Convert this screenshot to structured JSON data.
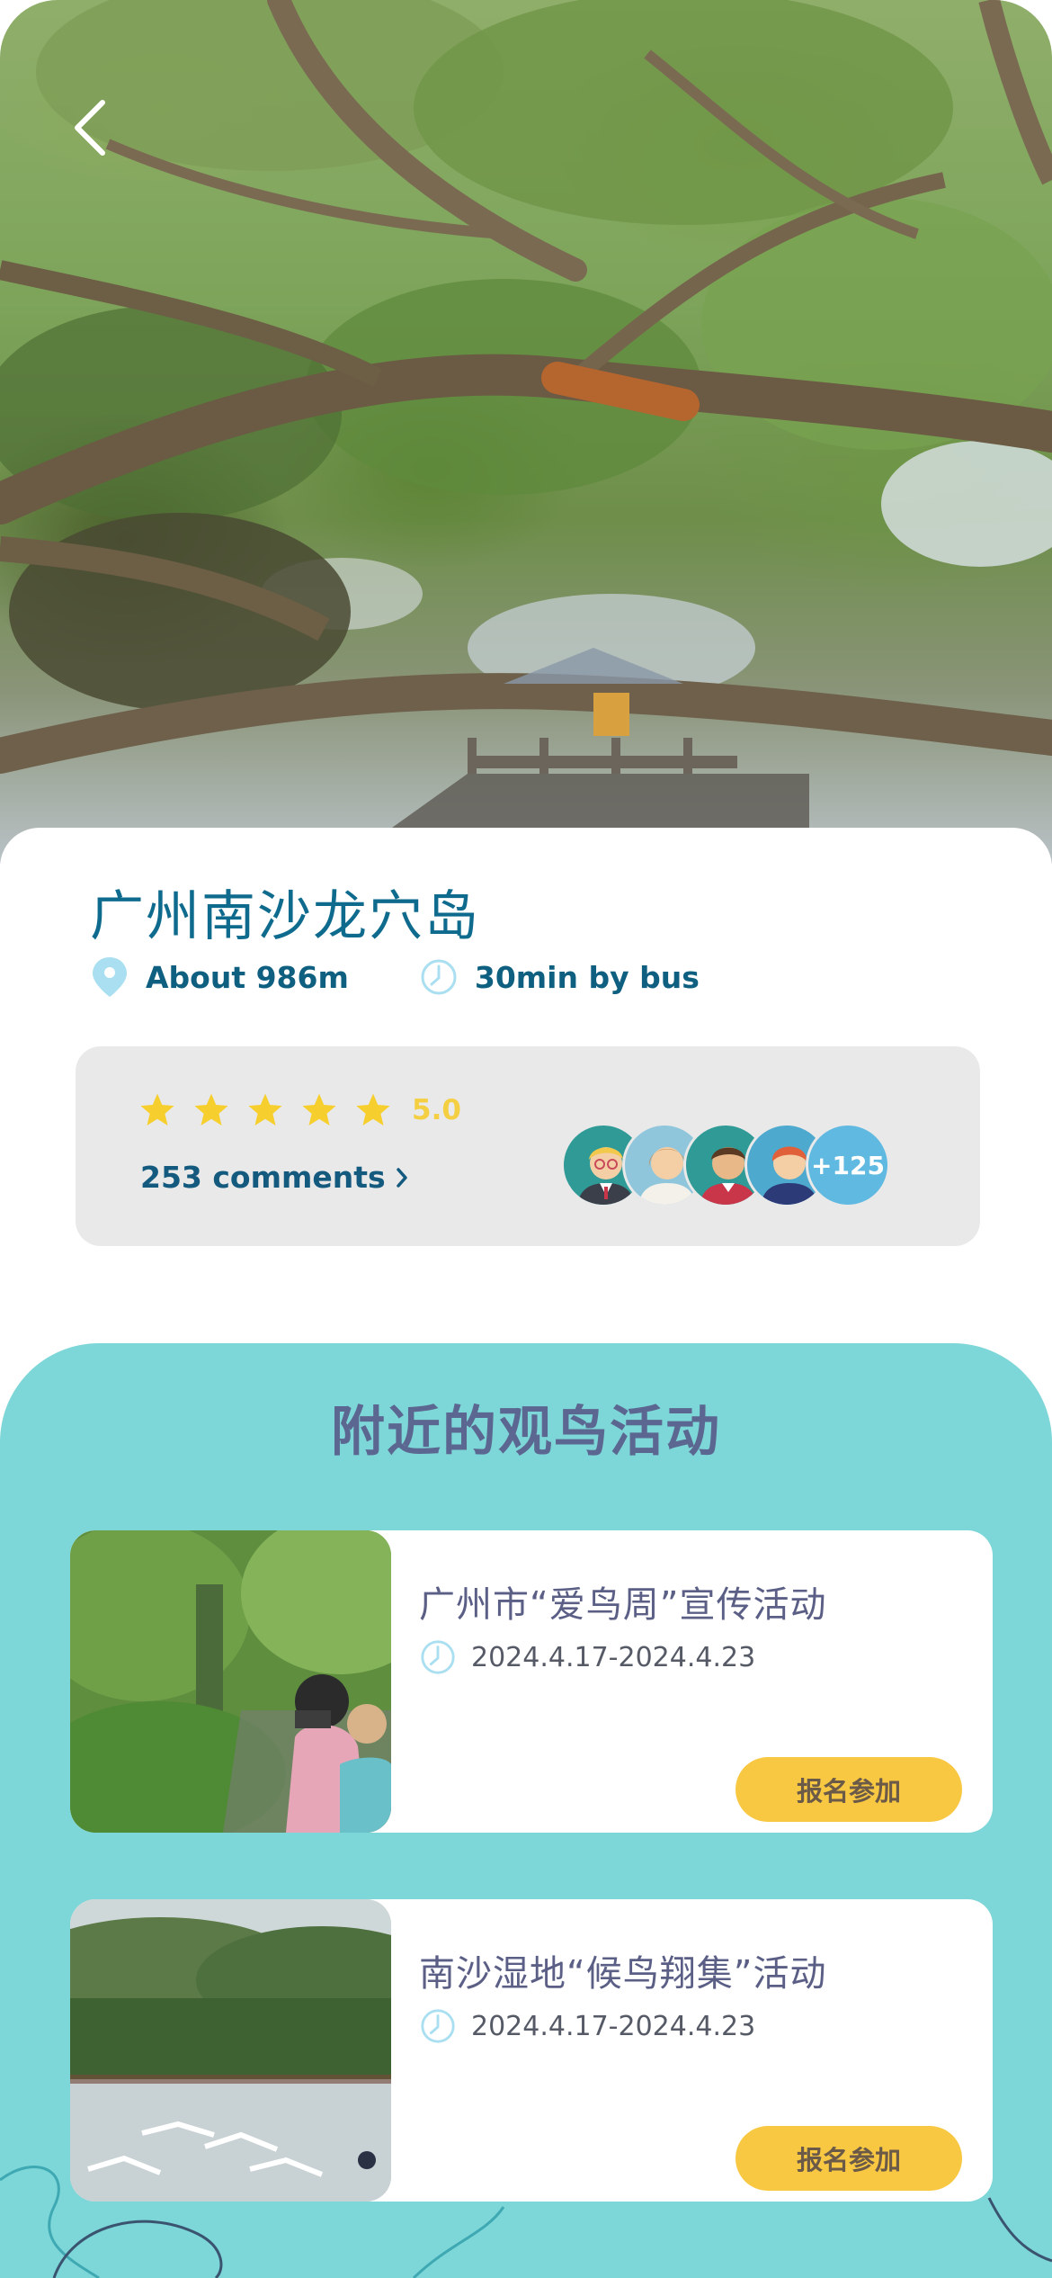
{
  "place": {
    "title": "广州南沙龙穴岛",
    "distance": "About 986m",
    "travel_time": "30min by bus"
  },
  "rating": {
    "stars": 5,
    "score": "5.0",
    "comments_label": "253 comments",
    "extra_count": "+125",
    "colors": {
      "star": "#f6cf2e",
      "score": "#f5cf42"
    }
  },
  "nearby": {
    "section_title": "附近的观鸟活动",
    "activities": [
      {
        "title": "广州市“爱鸟周”宣传活动",
        "date": "2024.4.17-2024.4.23",
        "button": "报名参加"
      },
      {
        "title": "南沙湿地“候鸟翔集”活动",
        "date": "2024.4.17-2024.4.23",
        "button": "报名参加"
      }
    ]
  },
  "icons": {
    "back": "chevron-left-icon",
    "location": "location-pin-icon",
    "clock": "clock-icon",
    "star": "star-icon",
    "chevron": "chevron-right-icon"
  },
  "colors": {
    "accent_teal": "#7dd6d7",
    "title_blue": "#0f6b8e",
    "button_yellow": "#f8c843",
    "rating_bg": "#e9e9e9"
  }
}
